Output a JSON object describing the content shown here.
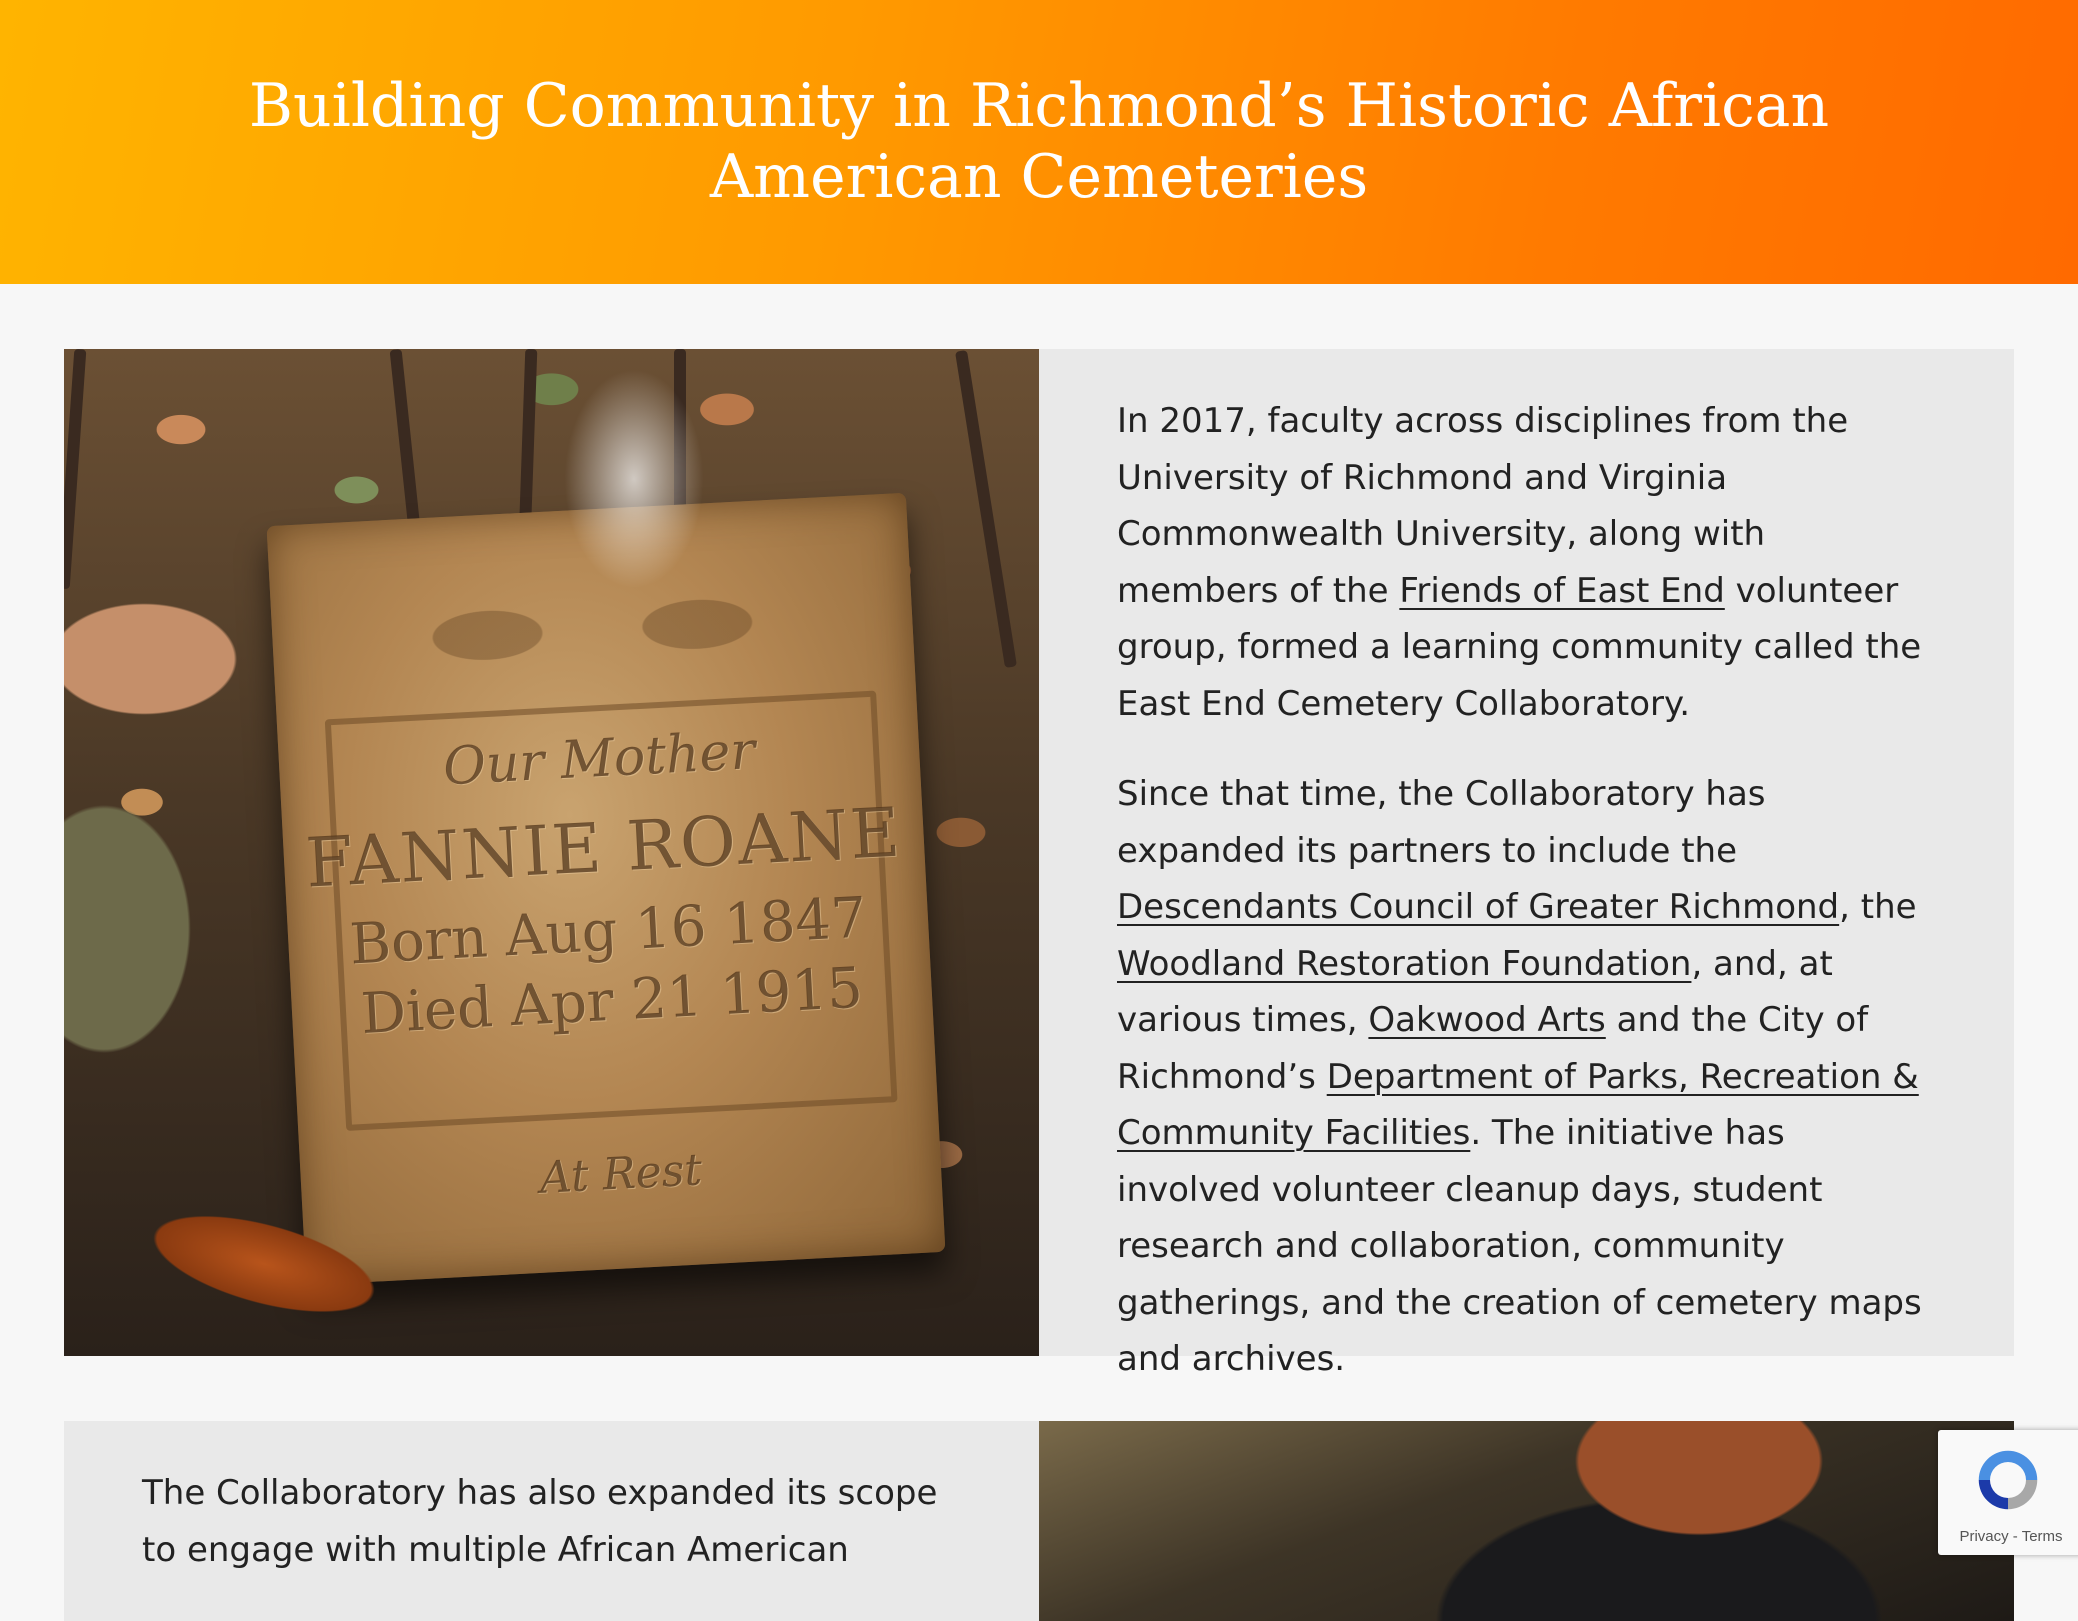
{
  "header": {
    "title": "Building Community in Richmond’s Historic African American Cemeteries"
  },
  "section1": {
    "image_alt": "Weathered gravestone engraved for Fannie Roane",
    "engraving": {
      "line1": "Our Mother",
      "line2": "FANNIE ROANE",
      "line3": "Born Aug 16 1847",
      "line4": "Died Apr 21 1915",
      "line5": "At Rest"
    },
    "p1": {
      "before": "In 2017, faculty across disciplines from the University of Richmond and Virginia Commonwealth University, along with members of the ",
      "link1": "Friends of East End",
      "after": " volunteer group, formed a learning community called the East End Cemetery Collaboratory."
    },
    "p2": {
      "t1": "Since that time, the Collaboratory has expanded its partners to include the ",
      "link1": "Descendants Council of Greater Richmond",
      "t2": ", the ",
      "link2": "Woodland Restoration Foundation",
      "t3": ", and, at various times, ",
      "link3": "Oakwood Arts",
      "t4": " and the City of Richmond’s ",
      "link4": "Department of Parks, Recreation & Community Facilities",
      "t5": ". The initiative has involved volunteer cleanup days, student research and collaboration, community gatherings, and the creation of cemetery maps and archives."
    }
  },
  "section2": {
    "p1": "The Collaboratory has also expanded its scope to engage with multiple African American"
  },
  "recaptcha": {
    "privacy": "Privacy",
    "separator": " - ",
    "terms": "Terms"
  },
  "colors": {
    "hero_start": "#ffb400",
    "hero_end": "#ff6a00",
    "card_bg": "#e9e9e9",
    "page_bg": "#f7f7f7"
  }
}
